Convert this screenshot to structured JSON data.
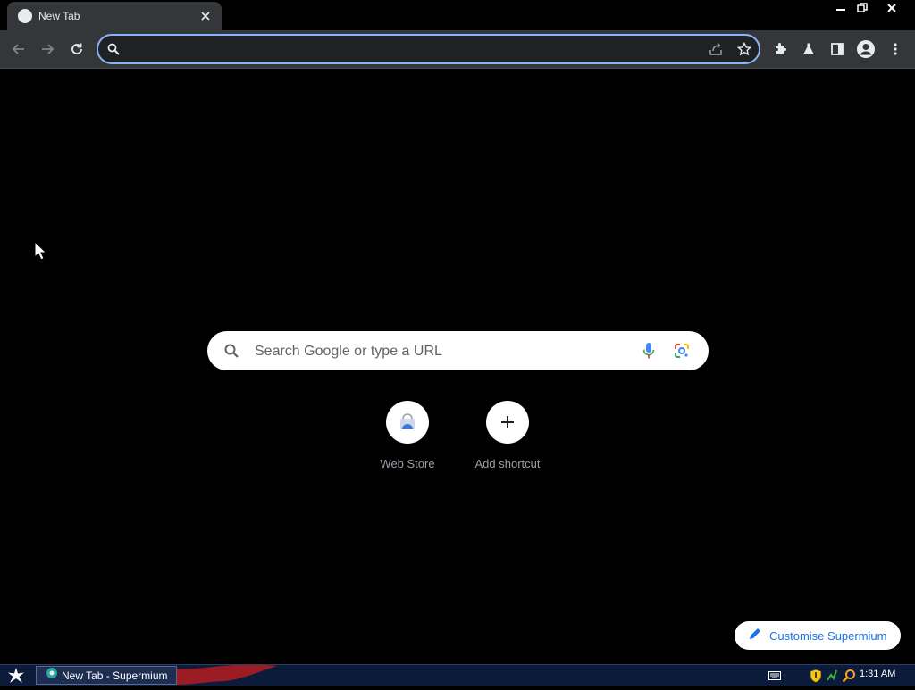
{
  "browser": {
    "tab": {
      "title": "New Tab",
      "favicon": "globe-icon"
    },
    "window_controls": [
      "minimize-icon",
      "restore-icon",
      "close-icon"
    ],
    "toolbar": {
      "nav": [
        "back-icon",
        "forward-icon",
        "reload-icon"
      ],
      "omnibox": {
        "value": "",
        "placeholder": ""
      },
      "right_icons": [
        "share-icon",
        "bookmark-star-icon",
        "extensions-icon",
        "labs-icon",
        "side-panel-icon",
        "profile-icon",
        "menu-icon"
      ],
      "accent": "#8ab4f8"
    }
  },
  "ntp": {
    "search": {
      "placeholder": "Search Google or type a URL"
    },
    "shortcuts": [
      {
        "label": "Web Store"
      },
      {
        "label": "Add shortcut"
      }
    ],
    "customise": {
      "label": "Customise Supermium"
    }
  },
  "taskbar": {
    "item": {
      "label": "New Tab - Supermium"
    },
    "clock": "1:31 AM",
    "colors": {
      "bar": "#0d1b3a"
    }
  }
}
